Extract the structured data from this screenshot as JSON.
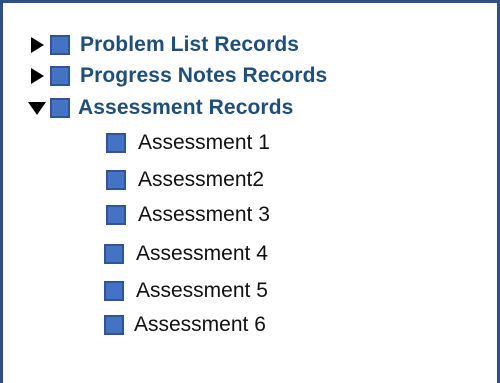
{
  "tree": {
    "items": [
      {
        "label": "Problem List Records",
        "expanded": false,
        "icon": "square-icon"
      },
      {
        "label": "Progress Notes Records",
        "expanded": false,
        "icon": "square-icon"
      },
      {
        "label": "Assessment Records",
        "expanded": true,
        "icon": "square-icon",
        "children": [
          {
            "label": "Assessment 1"
          },
          {
            "label": "Assessment2"
          },
          {
            "label": "Assessment 3"
          },
          {
            "label": "Assessment 4"
          },
          {
            "label": "Assessment 5"
          },
          {
            "label": "Assessment 6"
          }
        ]
      }
    ]
  },
  "colors": {
    "border": "#2f4f86",
    "node_fill": "#4472c4",
    "parent_text": "#1f4e79"
  }
}
